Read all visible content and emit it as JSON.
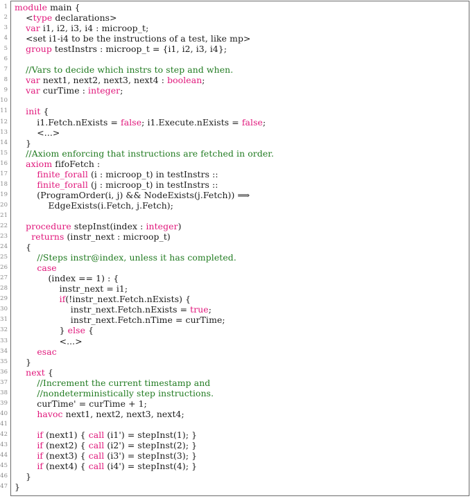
{
  "listing": {
    "lines": [
      {
        "n": "1",
        "tokens": [
          {
            "t": "kw",
            "v": "module"
          },
          {
            "t": "pl",
            "v": " main {"
          }
        ]
      },
      {
        "n": "2",
        "tokens": [
          {
            "t": "pl",
            "v": "    <"
          },
          {
            "t": "kw",
            "v": "type"
          },
          {
            "t": "pl",
            "v": " declarations>"
          }
        ]
      },
      {
        "n": "3",
        "tokens": [
          {
            "t": "pl",
            "v": "    "
          },
          {
            "t": "kw",
            "v": "var"
          },
          {
            "t": "pl",
            "v": " i1, i2, i3, i4 : microop_t;"
          }
        ]
      },
      {
        "n": "4",
        "tokens": [
          {
            "t": "pl",
            "v": "    <set i1-i4 to be the instructions of a test, like mp>"
          }
        ]
      },
      {
        "n": "5",
        "tokens": [
          {
            "t": "pl",
            "v": "    "
          },
          {
            "t": "kw",
            "v": "group"
          },
          {
            "t": "pl",
            "v": " testInstrs : microop_t = {i1, i2, i3, i4};"
          }
        ]
      },
      {
        "n": "6",
        "tokens": []
      },
      {
        "n": "7",
        "tokens": [
          {
            "t": "pl",
            "v": "    "
          },
          {
            "t": "cm",
            "v": "//Vars to decide which instrs to step and when."
          }
        ]
      },
      {
        "n": "8",
        "tokens": [
          {
            "t": "pl",
            "v": "    "
          },
          {
            "t": "kw",
            "v": "var"
          },
          {
            "t": "pl",
            "v": " next1, next2, next3, next4 : "
          },
          {
            "t": "kw",
            "v": "boolean"
          },
          {
            "t": "pl",
            "v": ";"
          }
        ]
      },
      {
        "n": "9",
        "tokens": [
          {
            "t": "pl",
            "v": "    "
          },
          {
            "t": "kw",
            "v": "var"
          },
          {
            "t": "pl",
            "v": " curTime : "
          },
          {
            "t": "kw",
            "v": "integer"
          },
          {
            "t": "pl",
            "v": ";"
          }
        ]
      },
      {
        "n": "10",
        "tokens": []
      },
      {
        "n": "11",
        "tokens": [
          {
            "t": "pl",
            "v": "    "
          },
          {
            "t": "kw",
            "v": "init"
          },
          {
            "t": "pl",
            "v": " {"
          }
        ]
      },
      {
        "n": "12",
        "tokens": [
          {
            "t": "pl",
            "v": "        i1.Fetch.nExists = "
          },
          {
            "t": "kw",
            "v": "false"
          },
          {
            "t": "pl",
            "v": "; i1.Execute.nExists = "
          },
          {
            "t": "kw",
            "v": "false"
          },
          {
            "t": "pl",
            "v": ";"
          }
        ]
      },
      {
        "n": "13",
        "tokens": [
          {
            "t": "pl",
            "v": "        <...>"
          }
        ]
      },
      {
        "n": "14",
        "tokens": [
          {
            "t": "pl",
            "v": "    }"
          }
        ]
      },
      {
        "n": "15",
        "tokens": [
          {
            "t": "pl",
            "v": "    "
          },
          {
            "t": "cm",
            "v": "//Axiom enforcing that instructions are fetched in order."
          }
        ]
      },
      {
        "n": "16",
        "tokens": [
          {
            "t": "pl",
            "v": "    "
          },
          {
            "t": "kw",
            "v": "axiom"
          },
          {
            "t": "pl",
            "v": " fifoFetch :"
          }
        ]
      },
      {
        "n": "17",
        "tokens": [
          {
            "t": "pl",
            "v": "        "
          },
          {
            "t": "kw",
            "v": "finite_forall"
          },
          {
            "t": "pl",
            "v": " (i : microop_t) in testInstrs ::"
          }
        ]
      },
      {
        "n": "18",
        "tokens": [
          {
            "t": "pl",
            "v": "        "
          },
          {
            "t": "kw",
            "v": "finite_forall"
          },
          {
            "t": "pl",
            "v": " (j : microop_t) in testInstrs ::"
          }
        ]
      },
      {
        "n": "19",
        "tokens": [
          {
            "t": "pl",
            "v": "        (ProgramOrder(i, j) && NodeExists(j.Fetch)) ⟹"
          }
        ]
      },
      {
        "n": "20",
        "tokens": [
          {
            "t": "pl",
            "v": "            EdgeExists(i.Fetch, j.Fetch);"
          }
        ]
      },
      {
        "n": "21",
        "tokens": []
      },
      {
        "n": "22",
        "tokens": [
          {
            "t": "pl",
            "v": "    "
          },
          {
            "t": "kw",
            "v": "procedure"
          },
          {
            "t": "pl",
            "v": " stepInst(index : "
          },
          {
            "t": "kw",
            "v": "integer"
          },
          {
            "t": "pl",
            "v": ")"
          }
        ]
      },
      {
        "n": "23",
        "tokens": [
          {
            "t": "pl",
            "v": "      "
          },
          {
            "t": "kw",
            "v": "returns"
          },
          {
            "t": "pl",
            "v": " (instr_next : microop_t)"
          }
        ]
      },
      {
        "n": "24",
        "tokens": [
          {
            "t": "pl",
            "v": "    {"
          }
        ]
      },
      {
        "n": "25",
        "tokens": [
          {
            "t": "pl",
            "v": "        "
          },
          {
            "t": "cm",
            "v": "//Steps instr@index, unless it has completed."
          }
        ]
      },
      {
        "n": "26",
        "tokens": [
          {
            "t": "pl",
            "v": "        "
          },
          {
            "t": "kw",
            "v": "case"
          }
        ]
      },
      {
        "n": "27",
        "tokens": [
          {
            "t": "pl",
            "v": "            (index == 1) : {"
          }
        ]
      },
      {
        "n": "28",
        "tokens": [
          {
            "t": "pl",
            "v": "                instr_next = i1;"
          }
        ]
      },
      {
        "n": "29",
        "tokens": [
          {
            "t": "pl",
            "v": "                "
          },
          {
            "t": "kw",
            "v": "if"
          },
          {
            "t": "pl",
            "v": "(!instr_next.Fetch.nExists) {"
          }
        ]
      },
      {
        "n": "30",
        "tokens": [
          {
            "t": "pl",
            "v": "                    instr_next.Fetch.nExists = "
          },
          {
            "t": "kw",
            "v": "true"
          },
          {
            "t": "pl",
            "v": ";"
          }
        ]
      },
      {
        "n": "31",
        "tokens": [
          {
            "t": "pl",
            "v": "                    instr_next.Fetch.nTime = curTime;"
          }
        ]
      },
      {
        "n": "32",
        "tokens": [
          {
            "t": "pl",
            "v": "                } "
          },
          {
            "t": "kw",
            "v": "else"
          },
          {
            "t": "pl",
            "v": " {"
          }
        ]
      },
      {
        "n": "33",
        "tokens": [
          {
            "t": "pl",
            "v": "                <...>"
          }
        ]
      },
      {
        "n": "34",
        "tokens": [
          {
            "t": "pl",
            "v": "        "
          },
          {
            "t": "kw",
            "v": "esac"
          }
        ]
      },
      {
        "n": "35",
        "tokens": [
          {
            "t": "pl",
            "v": "    }"
          }
        ]
      },
      {
        "n": "36",
        "tokens": [
          {
            "t": "pl",
            "v": "    "
          },
          {
            "t": "kw",
            "v": "next"
          },
          {
            "t": "pl",
            "v": " {"
          }
        ]
      },
      {
        "n": "37",
        "tokens": [
          {
            "t": "pl",
            "v": "        "
          },
          {
            "t": "cm",
            "v": "//Increment the current timestamp and"
          }
        ]
      },
      {
        "n": "38",
        "tokens": [
          {
            "t": "pl",
            "v": "        "
          },
          {
            "t": "cm",
            "v": "//nondeterministically step instructions."
          }
        ]
      },
      {
        "n": "39",
        "tokens": [
          {
            "t": "pl",
            "v": "        curTime' = curTime + 1;"
          }
        ]
      },
      {
        "n": "40",
        "tokens": [
          {
            "t": "pl",
            "v": "        "
          },
          {
            "t": "kw",
            "v": "havoc"
          },
          {
            "t": "pl",
            "v": " next1, next2, next3, next4;"
          }
        ]
      },
      {
        "n": "41",
        "tokens": []
      },
      {
        "n": "42",
        "tokens": [
          {
            "t": "pl",
            "v": "        "
          },
          {
            "t": "kw",
            "v": "if"
          },
          {
            "t": "pl",
            "v": " (next1) { "
          },
          {
            "t": "kw",
            "v": "call"
          },
          {
            "t": "pl",
            "v": " (i1') = stepInst(1); }"
          }
        ]
      },
      {
        "n": "43",
        "tokens": [
          {
            "t": "pl",
            "v": "        "
          },
          {
            "t": "kw",
            "v": "if"
          },
          {
            "t": "pl",
            "v": " (next2) { "
          },
          {
            "t": "kw",
            "v": "call"
          },
          {
            "t": "pl",
            "v": " (i2') = stepInst(2); }"
          }
        ]
      },
      {
        "n": "44",
        "tokens": [
          {
            "t": "pl",
            "v": "        "
          },
          {
            "t": "kw",
            "v": "if"
          },
          {
            "t": "pl",
            "v": " (next3) { "
          },
          {
            "t": "kw",
            "v": "call"
          },
          {
            "t": "pl",
            "v": " (i3') = stepInst(3); }"
          }
        ]
      },
      {
        "n": "45",
        "tokens": [
          {
            "t": "pl",
            "v": "        "
          },
          {
            "t": "kw",
            "v": "if"
          },
          {
            "t": "pl",
            "v": " (next4) { "
          },
          {
            "t": "kw",
            "v": "call"
          },
          {
            "t": "pl",
            "v": " (i4') = stepInst(4); }"
          }
        ]
      },
      {
        "n": "46",
        "tokens": [
          {
            "t": "pl",
            "v": "    }"
          }
        ]
      },
      {
        "n": "47",
        "tokens": [
          {
            "t": "pl",
            "v": "}"
          }
        ]
      }
    ]
  },
  "colors": {
    "keyword": "#e0157a",
    "comment": "#1f7a1f",
    "text": "#1a1a1a",
    "line_number": "#8a8a8a",
    "frame": "#6a6a6a"
  }
}
